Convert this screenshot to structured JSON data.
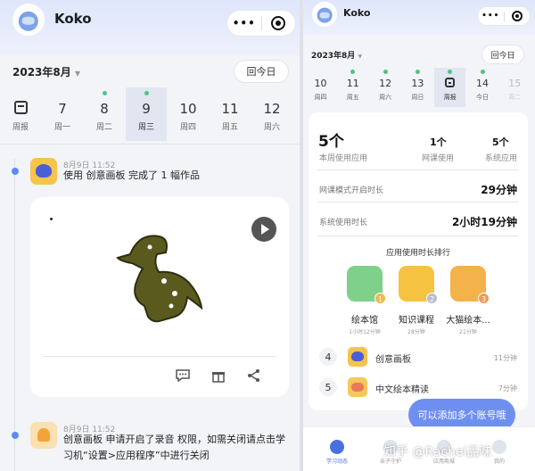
{
  "left": {
    "user_name": "Koko",
    "capsule_dots": "•••",
    "month": "2023年8月",
    "month_caret": "▼",
    "today_label": "回今日",
    "days": [
      {
        "num": "",
        "wk": "周报",
        "dot": false,
        "selected": false,
        "is_report": true
      },
      {
        "num": "7",
        "wk": "周一",
        "dot": false,
        "selected": false
      },
      {
        "num": "8",
        "wk": "周二",
        "dot": true,
        "selected": false
      },
      {
        "num": "9",
        "wk": "周三",
        "dot": true,
        "selected": true
      },
      {
        "num": "10",
        "wk": "周四",
        "dot": false,
        "selected": false
      },
      {
        "num": "11",
        "wk": "周五",
        "dot": false,
        "selected": false
      },
      {
        "num": "12",
        "wk": "周六",
        "dot": false,
        "selected": false
      }
    ],
    "feed": [
      {
        "time": "8月9日 11:52",
        "text": "使用 创意画板 完成了 1 幅作品",
        "icon": "creative-board-app-icon"
      },
      {
        "time": "8月9日 11:52",
        "text": "创意画板 申请开启了录音 权限，如需关闭请点击学习机“设置>应用程序”中进行关闭",
        "icon": "bell-icon"
      }
    ],
    "actions": [
      "comment-icon",
      "gift-icon",
      "share-icon"
    ]
  },
  "right": {
    "user_name": "Koko",
    "capsule_dots": "•••",
    "month": "2023年8月",
    "month_caret": "▼",
    "today_label": "回今日",
    "days": [
      {
        "num": "10",
        "wk": "周四",
        "dot": false
      },
      {
        "num": "11",
        "wk": "周五",
        "dot": true
      },
      {
        "num": "12",
        "wk": "周六",
        "dot": true
      },
      {
        "num": "13",
        "wk": "周日",
        "dot": true
      },
      {
        "num": "",
        "wk": "周报",
        "dot": true,
        "selected": true,
        "is_report": true
      },
      {
        "num": "14",
        "wk": "今日",
        "dot": true
      },
      {
        "num": "15",
        "wk": "周二",
        "dot": false,
        "faded": true
      }
    ],
    "stats": [
      {
        "value": "5个",
        "label": "本周使用应用"
      },
      {
        "value": "1个",
        "label": "网课使用"
      },
      {
        "value": "5个",
        "label": "系统应用"
      }
    ],
    "rows": [
      {
        "label": "网课模式开启时长",
        "value": "29分钟"
      },
      {
        "label": "系统使用时长",
        "value": "2小时19分钟"
      }
    ],
    "ranking_title": "应用使用时长排行",
    "ranking": [
      {
        "name": "绘本馆",
        "time": "1小时12分钟",
        "badge": "1",
        "color": "#7fd08a",
        "badge_color": "#f2b84b"
      },
      {
        "name": "知识课程",
        "time": "28分钟",
        "badge": "2",
        "color": "#f6c340",
        "badge_color": "#b6bfd0"
      },
      {
        "name": "大猫绘本...",
        "time": "21分钟",
        "badge": "3",
        "color": "#f4b24a",
        "badge_color": "#e89b52"
      }
    ],
    "list": [
      {
        "idx": "4",
        "name": "创意画板",
        "time": "11分钟"
      },
      {
        "idx": "5",
        "name": "中文绘本精读",
        "time": "7分钟"
      }
    ],
    "bubble": "可以添加多个账号哦",
    "tabs": [
      {
        "label": "学习动态",
        "active": true
      },
      {
        "label": "亲子守护",
        "active": false
      },
      {
        "label": "应用商城",
        "active": false
      },
      {
        "label": "我的",
        "active": false
      }
    ]
  },
  "watermark": "知乎 @Rachel品味"
}
